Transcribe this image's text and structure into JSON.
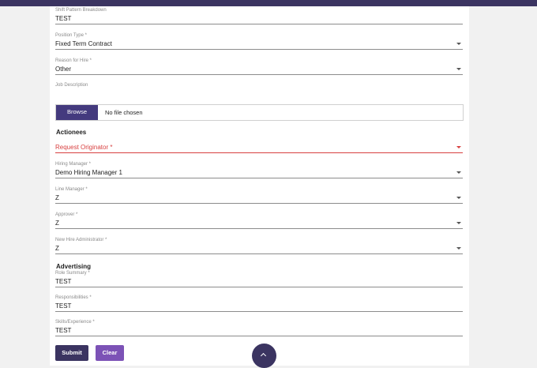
{
  "fields": {
    "shift_pattern": {
      "label": "Shift Pattern Breakdown",
      "value": "TEST"
    },
    "position_type": {
      "label": "Position Type *",
      "value": "Fixed Term Contract"
    },
    "reason_for_hire": {
      "label": "Reason for Hire *",
      "value": "Other"
    },
    "job_description": {
      "label": "Job Description"
    },
    "request_originator": {
      "label": "Request Originator *"
    },
    "hiring_manager": {
      "label": "Hiring Manager *",
      "value": "Demo Hiring Manager 1"
    },
    "line_manager": {
      "label": "Line Manager *",
      "value": "Z"
    },
    "approver": {
      "label": "Approver *",
      "value": "Z"
    },
    "new_hire_admin": {
      "label": "New Hire Administrator *",
      "value": "Z"
    },
    "role_summary": {
      "label": "Role Summary *",
      "value": "TEST"
    },
    "responsibilities": {
      "label": "Responsibilities *",
      "value": "TEST"
    },
    "skills_experience": {
      "label": "Skills/Experience *",
      "value": "TEST"
    }
  },
  "file_upload": {
    "browse_label": "Browse",
    "status": "No file chosen"
  },
  "sections": {
    "actionees": "Actionees",
    "advertising": "Advertising"
  },
  "buttons": {
    "submit": "Submit",
    "clear": "Clear"
  },
  "colors": {
    "primary": "#3b3461",
    "browse": "#443a7e",
    "clear": "#7c52b6",
    "error": "#d84040"
  }
}
